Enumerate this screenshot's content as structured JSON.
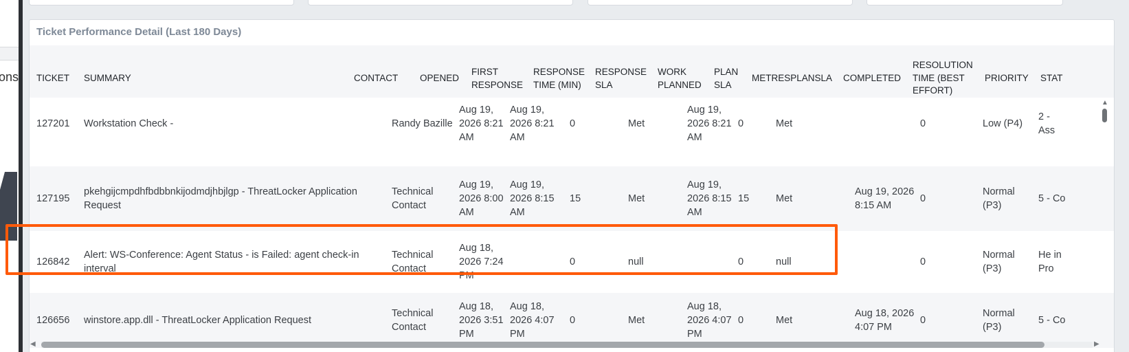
{
  "backdrop": {
    "text_fragment": "ons"
  },
  "panel": {
    "title": "Ticket Performance Detail (Last 180 Days)"
  },
  "columns": [
    "TICKET",
    "SUMMARY",
    "CONTACT",
    "OPENED",
    "FIRST RESPONSE",
    "RESPONSE TIME (MIN)",
    "RESPONSE SLA",
    "WORK PLANNED",
    "PLAN SLA",
    "METRESPLANSLA",
    "COMPLETED",
    "RESOLUTION TIME (BEST EFFORT)",
    "PRIORITY",
    "STAT"
  ],
  "rows": [
    {
      "ticket": "127201",
      "summary": "Workstation Check -",
      "contact": "Randy Bazille",
      "opened": "Aug 19, 2026 8:21 AM",
      "first_response": "Aug 19, 2026 8:21 AM",
      "response_time": "0",
      "response_sla": "Met",
      "work_planned": "Aug 19, 2026 8:21 AM",
      "plan_sla": "0",
      "met_res_plan_sla": "Met",
      "completed": "",
      "resolution_time": "0",
      "priority": "Low (P4)",
      "status": "2 - Ass"
    },
    {
      "ticket": "127195",
      "summary": "pkehgijcmpdhfbdbbnkijodmdjhbjlgp - ThreatLocker Application Request",
      "contact": "Technical Contact",
      "opened": "Aug 19, 2026 8:00 AM",
      "first_response": "Aug 19, 2026 8:15 AM",
      "response_time": "15",
      "response_sla": "Met",
      "work_planned": "Aug 19, 2026 8:15 AM",
      "plan_sla": "15",
      "met_res_plan_sla": "Met",
      "completed": "Aug 19, 2026 8:15 AM",
      "resolution_time": "0",
      "priority": "Normal (P3)",
      "status": "5 - Co"
    },
    {
      "ticket": "126842",
      "summary": "Alert: WS-Conference: Agent Status - is Failed: agent check-in interval",
      "contact": "Technical Contact",
      "opened": "Aug 18, 2026 7:24 PM",
      "first_response": "",
      "response_time": "0",
      "response_sla": "null",
      "work_planned": "",
      "plan_sla": "0",
      "met_res_plan_sla": "null",
      "completed": "",
      "resolution_time": "0",
      "priority": "Normal (P3)",
      "status": "He in Pro"
    },
    {
      "ticket": "126656",
      "summary": "winstore.app.dll - ThreatLocker Application Request",
      "contact": "Technical Contact",
      "opened": "Aug 18, 2026 3:51 PM",
      "first_response": "Aug 18, 2026 4:07 PM",
      "response_time": "0",
      "response_sla": "Met",
      "work_planned": "Aug 18, 2026 4:07 PM",
      "plan_sla": "0",
      "met_res_plan_sla": "Met",
      "completed": "Aug 18, 2026 4:07 PM",
      "resolution_time": "0",
      "priority": "Normal (P3)",
      "status": "5 - Co"
    }
  ],
  "scrollbars": {
    "left_arrow": "◀",
    "right_arrow": "▶",
    "up_arrow": "▲",
    "horizontal_position": 0.0,
    "vertical_position": 0.0
  },
  "highlight_color": "#ff5a0a"
}
